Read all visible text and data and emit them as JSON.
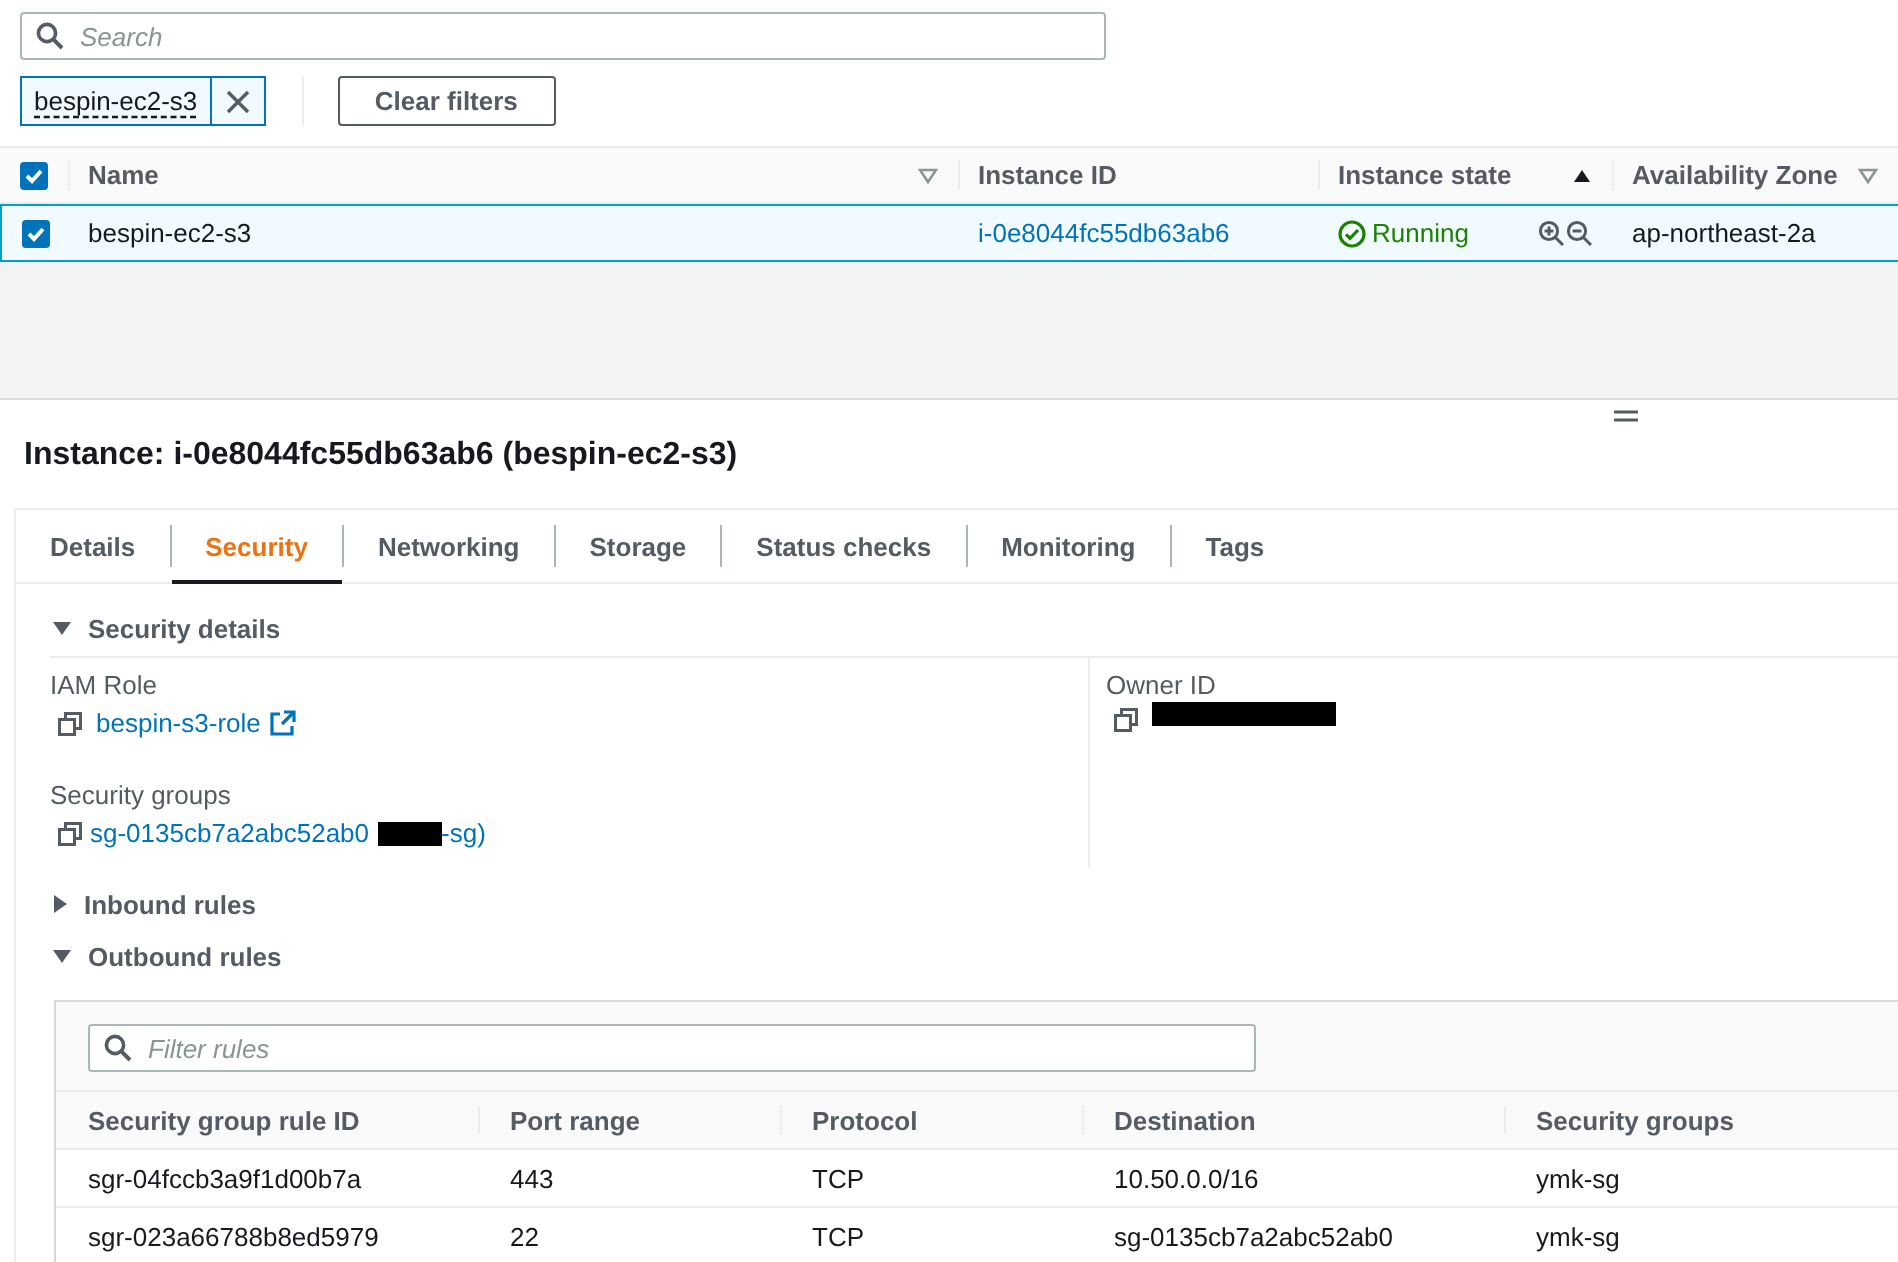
{
  "search": {
    "placeholder": "Search"
  },
  "filter_token": {
    "label": "bespin-ec2-s3"
  },
  "clear_filters": "Clear filters",
  "instances": {
    "all_selected": true,
    "columns": [
      {
        "label": "Name",
        "sortable": true,
        "sorted": false
      },
      {
        "label": "Instance ID",
        "sortable": false
      },
      {
        "label": "Instance state",
        "sortable": true,
        "sorted": true
      },
      {
        "label": "Availability Zone",
        "sortable": true,
        "sorted": false
      }
    ],
    "rows": [
      {
        "selected": true,
        "name": "bespin-ec2-s3",
        "instance_id": "i-0e8044fc55db63ab6",
        "state": "Running",
        "zone": "ap-northeast-2a"
      }
    ]
  },
  "details": {
    "title": "Instance: i-0e8044fc55db63ab6 (bespin-ec2-s3)",
    "tabs": [
      {
        "label": "Details",
        "selected": false
      },
      {
        "label": "Security",
        "selected": true
      },
      {
        "label": "Networking",
        "selected": false
      },
      {
        "label": "Storage",
        "selected": false
      },
      {
        "label": "Status checks",
        "selected": false
      },
      {
        "label": "Monitoring",
        "selected": false
      },
      {
        "label": "Tags",
        "selected": false
      }
    ],
    "security_details": {
      "title": "Security details",
      "expanded": true,
      "iam_role": {
        "label": "IAM Role",
        "value": "bespin-s3-role"
      },
      "security_groups": {
        "label": "Security groups",
        "value": "sg-0135cb7a2abc52ab0",
        "tail": "-sg)"
      },
      "owner_id": {
        "label": "Owner ID"
      }
    },
    "inbound_rules": {
      "title": "Inbound rules",
      "expanded": false
    },
    "outbound_rules": {
      "title": "Outbound rules",
      "expanded": true,
      "filter": {
        "placeholder": "Filter rules"
      },
      "columns": [
        "Security group rule ID",
        "Port range",
        "Protocol",
        "Destination",
        "Security groups"
      ],
      "rows": [
        [
          "sgr-04fccb3a9f1d00b7a",
          "443",
          "TCP",
          "10.50.0.0/16",
          "ymk-sg"
        ],
        [
          "sgr-023a66788b8ed5979",
          "22",
          "TCP",
          "sg-0135cb7a2abc52ab0",
          "ymk-sg"
        ]
      ]
    }
  }
}
